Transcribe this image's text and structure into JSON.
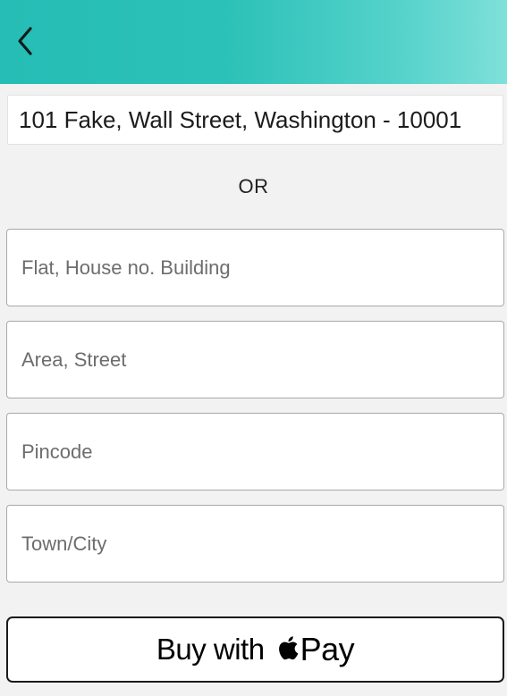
{
  "header": {
    "back_icon": "chevron-left-icon",
    "colors": {
      "gradient_start": "#25bdb5",
      "gradient_end": "#7fe0d9"
    }
  },
  "address": {
    "saved_address": "101 Fake, Wall Street, Washington - 10001",
    "or_label": "OR",
    "fields": {
      "flat_placeholder": "Flat, House no. Building",
      "area_placeholder": "Area, Street",
      "pincode_placeholder": "Pincode",
      "town_placeholder": "Town/City"
    }
  },
  "payment": {
    "label_prefix": "Buy with",
    "brand_icon": "apple-logo-icon",
    "label_suffix": "Pay"
  }
}
